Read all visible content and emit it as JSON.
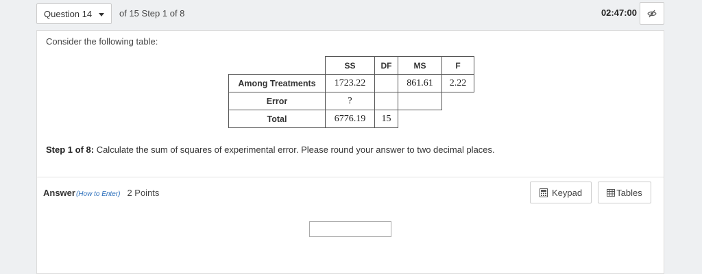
{
  "header": {
    "question_select": "Question 14",
    "of_step": "of 15 Step 1 of 8",
    "timer": "02:47:00"
  },
  "problem": {
    "prompt": "Consider the following table:",
    "table": {
      "columns": [
        "SS",
        "DF",
        "MS",
        "F"
      ],
      "rows": [
        {
          "label": "Among Treatments",
          "ss": "1723.22",
          "df": "",
          "ms": "861.61",
          "f": "2.22"
        },
        {
          "label": "Error",
          "ss": "?",
          "df": "",
          "ms": ""
        },
        {
          "label": "Total",
          "ss": "6776.19",
          "df": "15"
        }
      ]
    },
    "step_label": "Step 1 of 8:",
    "step_text": " Calculate the sum of squares of experimental error. Please round your answer to two decimal places."
  },
  "answer": {
    "label": "Answer",
    "how_to": "(How to Enter)",
    "points": "2 Points",
    "keypad_label": "Keypad",
    "tables_label": "Tables",
    "value": ""
  },
  "icons": {
    "visibility": "eye-slash-icon",
    "keypad": "calculator-icon",
    "tables": "table-icon",
    "dropdown": "caret-down-icon"
  }
}
